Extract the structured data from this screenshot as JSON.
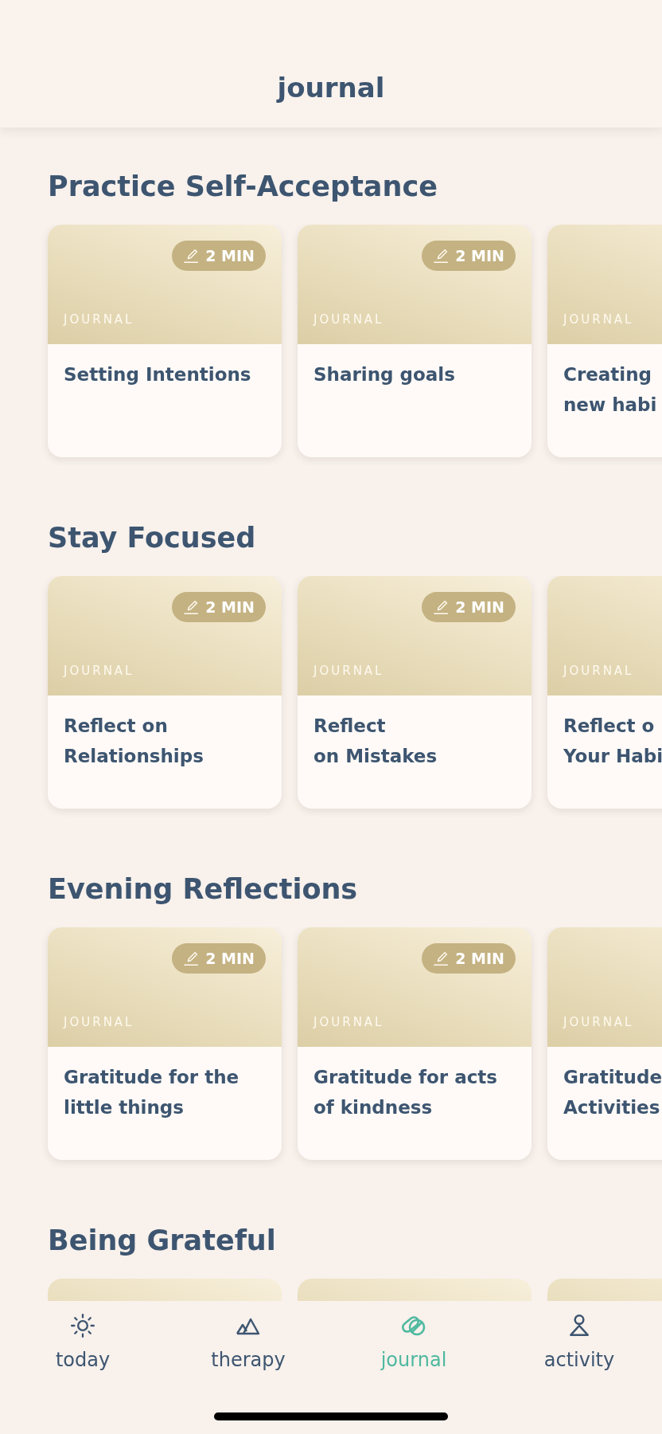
{
  "header": {
    "title": "journal"
  },
  "sections": [
    {
      "title": "Practice Self-Acceptance",
      "cards": [
        {
          "kind": "journal",
          "duration": "2 MIN",
          "label": "JOURNAL",
          "title": "Setting Intentions"
        },
        {
          "kind": "journal",
          "duration": "2 MIN",
          "label": "JOURNAL",
          "title": "Sharing goals"
        },
        {
          "kind": "journal",
          "label": "JOURNAL",
          "title": "Creating\nnew habi"
        }
      ]
    },
    {
      "title": "Stay Focused",
      "cards": [
        {
          "kind": "journal",
          "duration": "2 MIN",
          "label": "JOURNAL",
          "title": "Reflect on\nRelationships"
        },
        {
          "kind": "journal",
          "duration": "2 MIN",
          "label": "JOURNAL",
          "title": "Reflect\non Mistakes"
        },
        {
          "kind": "journal",
          "label": "JOURNAL",
          "title": "Reflect o\nYour Habi"
        }
      ]
    },
    {
      "title": "Evening Reflections",
      "cards": [
        {
          "kind": "journal",
          "duration": "2 MIN",
          "label": "JOURNAL",
          "title": "Gratitude for the\nlittle things"
        },
        {
          "kind": "journal",
          "duration": "2 MIN",
          "label": "JOURNAL",
          "title": "Gratitude for acts\nof kindness"
        },
        {
          "kind": "journal",
          "label": "JOURNAL",
          "title": "Gratitude\nActivities"
        }
      ]
    },
    {
      "title": "Being Grateful",
      "cards": [
        {
          "kind": "journal"
        },
        {
          "kind": "journal"
        },
        {
          "kind": "journal"
        }
      ]
    }
  ],
  "tabs": [
    {
      "kind": "sun",
      "label": "today",
      "selected": false
    },
    {
      "kind": "mountains",
      "label": "therapy",
      "selected": false
    },
    {
      "kind": "pill",
      "label": "journal",
      "selected": true
    },
    {
      "kind": "person",
      "label": "activity",
      "selected": false
    }
  ]
}
